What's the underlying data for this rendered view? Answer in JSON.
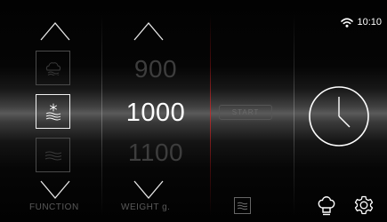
{
  "status": {
    "time": "10:10",
    "wifi_icon": "wifi-icon"
  },
  "function_column": {
    "label": "FUNCTION",
    "up_icon": "chevron-up-icon",
    "down_icon": "chevron-down-icon",
    "options": [
      {
        "icon": "steam-icon",
        "state": "dim"
      },
      {
        "icon": "defrost-icon",
        "state": "selected"
      },
      {
        "icon": "heat-waves-icon",
        "state": "dim"
      }
    ]
  },
  "weight_column": {
    "label": "WEIGHT g.",
    "unit": "g.",
    "values": [
      "900",
      "1000",
      "1100"
    ],
    "selected": "1000"
  },
  "start_button": {
    "label": "START"
  },
  "timer": {
    "icon": "clock-icon"
  },
  "bottom_icons": [
    "program-list-icon",
    "chef-hat-icon",
    "settings-gear-icon"
  ],
  "colors": {
    "background": "#050505",
    "active": "#ffffff",
    "dim": "#3d3d3d",
    "divider_red": "#c82828"
  }
}
